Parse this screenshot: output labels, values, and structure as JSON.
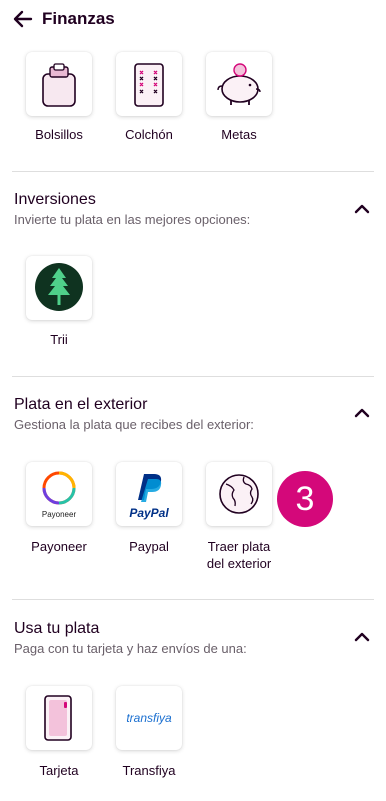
{
  "header": {
    "title": "Finanzas",
    "back_icon": "arrow-left-icon"
  },
  "savings": {
    "items": [
      {
        "label": "Bolsillos",
        "icon": "pocket-bag-icon"
      },
      {
        "label": "Colchón",
        "icon": "mattress-icon"
      },
      {
        "label": "Metas",
        "icon": "piggy-bank-icon"
      }
    ]
  },
  "inversiones": {
    "title": "Inversiones",
    "subtitle": "Invierte tu plata en las mejores opciones:",
    "items": [
      {
        "label": "Trii",
        "icon": "trii-tree-logo"
      }
    ]
  },
  "exterior": {
    "title": "Plata en el exterior",
    "subtitle": "Gestiona la plata que recibes del exterior:",
    "items": [
      {
        "label": "Payoneer",
        "icon": "payoneer-logo",
        "logo_text": "Payoneer"
      },
      {
        "label": "Paypal",
        "icon": "paypal-logo",
        "logo_text": "PayPal"
      },
      {
        "label_line1": "Traer plata",
        "label_line2": "del exterior",
        "icon": "globe-icon"
      }
    ],
    "badge": "3"
  },
  "usa_plata": {
    "title": "Usa tu plata",
    "subtitle": "Paga con tu tarjeta y haz envíos de una:",
    "items": [
      {
        "label": "Tarjeta",
        "icon": "card-icon"
      },
      {
        "label": "Transfiya",
        "icon": "transfiya-logo",
        "logo_text": "transfiya"
      }
    ]
  },
  "colors": {
    "brand_pink": "#d4087a",
    "text_dark": "#200020",
    "subtle_text": "#6a606a",
    "trii_green": "#0f3320"
  }
}
